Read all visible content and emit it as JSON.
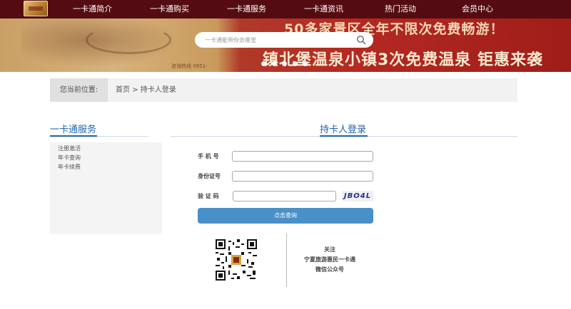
{
  "nav": {
    "items": [
      "一卡通简介",
      "一卡通购买",
      "一卡通服务",
      "一卡通资讯",
      "热门活动",
      "会员中心"
    ]
  },
  "banner": {
    "promo_line_1": "50多家景区全年不限次免费畅游！",
    "promo_line_2": "镇北堡温泉小镇3次免费温泉  钜惠来袭",
    "small_text": "咨询热线 0951-",
    "search_placeholder": "一卡通能带你去哪里",
    "slide_count": 5
  },
  "breadcrumb": {
    "label": "您当前位置:",
    "path": "首页 > 持卡人登录"
  },
  "sidebar": {
    "title": "一卡通服务",
    "links": [
      "注册激活",
      "年卡查询",
      "年卡续费"
    ]
  },
  "login": {
    "title": "持卡人登录",
    "phone_label": "手 机 号",
    "id_label": "身份证号",
    "captcha_label": "验 证 码",
    "captcha_code": "JBO4L",
    "submit_label": "点击查询"
  },
  "wechat": {
    "line_1": "关注",
    "line_2": "宁夏旅游惠民一卡通",
    "line_3": "微信公众号"
  },
  "colors": {
    "nav_bg": "#540c12",
    "accent": "#1f63ad",
    "button": "#4a90c8"
  }
}
